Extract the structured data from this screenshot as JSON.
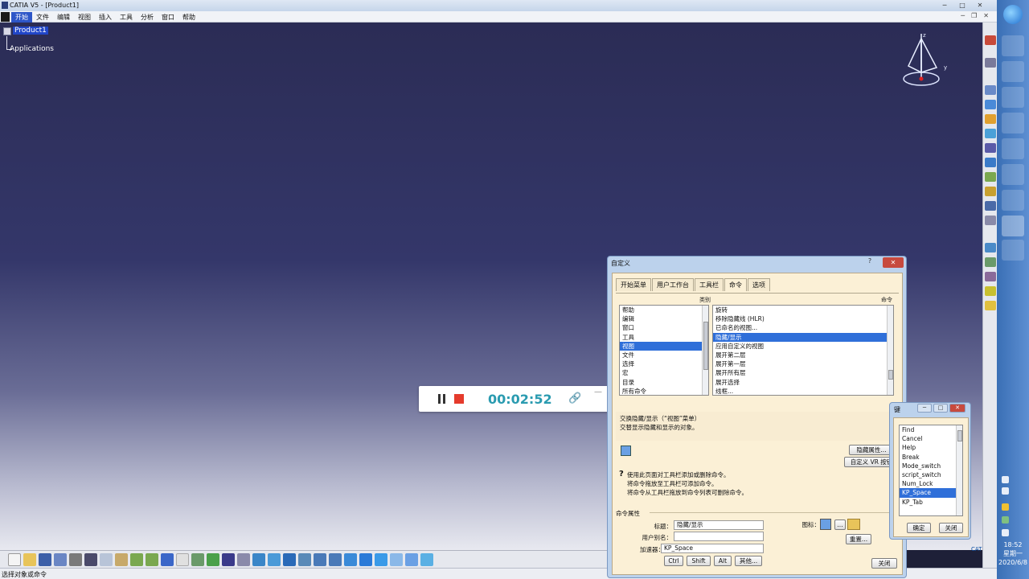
{
  "window": {
    "title": "CATIA V5 - [Product1]",
    "min": "─",
    "max": "□",
    "close": "✕",
    "mdi_min": "─",
    "mdi_restore": "❐",
    "mdi_close": "✕"
  },
  "menu": [
    "开始",
    "文件",
    "编辑",
    "视图",
    "插入",
    "工具",
    "分析",
    "窗口",
    "帮助"
  ],
  "tree": {
    "root": "Product1",
    "child": "Applications"
  },
  "compass": {
    "axis_z": "z",
    "axis_y": "y"
  },
  "recorder": {
    "time": "00:02:52",
    "link_icon": "🔗",
    "minimize": "—"
  },
  "status": {
    "text": "选择对象或命令"
  },
  "catia_logo": "CATIA",
  "taskbar": {
    "time": "18:52",
    "day": "星期一",
    "date": "2020/6/8"
  },
  "customize": {
    "title": "自定义",
    "help": "?",
    "close": "✕",
    "tabs": [
      "开始菜单",
      "用户工作台",
      "工具栏",
      "命令",
      "选项"
    ],
    "selected_tab": "命令",
    "categories_header": "类别",
    "commands_header": "命令",
    "categories": [
      "帮助",
      "编辑",
      "窗口",
      "工具",
      "视图",
      "文件",
      "选择",
      "宏",
      "目录",
      "所有命令"
    ],
    "selected_category": "视图",
    "commands": [
      "旋转",
      "移除隐藏线 (HLR)",
      "已命名的视图...",
      "隐藏/显示",
      "应用自定义的视图",
      "展开第二层",
      "展开第一层",
      "展开所有层",
      "展开选择",
      "线框..."
    ],
    "selected_command": "隐藏/显示",
    "description_line1": "交换隐藏/显示（“视图”菜单）",
    "description_line2": "交替显示隐藏和显示的对象。",
    "btn_hide_props": "隐藏属性...",
    "btn_custom_vr": "自定义 VR 按钮",
    "hint_lines": [
      "使用此页面对工具栏添加或删除命令。",
      "将命令拖放至工具栏可添加命令。",
      "将命令从工具栏拖放到命令列表可删除命令。"
    ],
    "props_header": "命令属性",
    "label_title": "标题：",
    "value_title": "隐藏/显示",
    "label_alias": "用户别名：",
    "value_alias": "",
    "label_accel": "加速器：",
    "value_accel": "KP_Space",
    "label_icon": "图标：",
    "btn_ellipsis": "...",
    "mod_buttons": [
      "Ctrl",
      "Shift",
      "Alt",
      "其他..."
    ],
    "btn_reset": "重置...",
    "btn_close": "关闭"
  },
  "keys": {
    "title": "键",
    "list": [
      "Find",
      "Cancel",
      "Help",
      "Break",
      "Mode_switch",
      "script_switch",
      "Num_Lock",
      "KP_Space",
      "KP_Tab"
    ],
    "selected": "KP_Space",
    "btn_ok": "确定",
    "btn_close": "关闭"
  },
  "colors": {
    "accent": "#2f6fd9",
    "dialog_bg": "#fbf0d6",
    "viewport_top": "#2b2c55",
    "recorder_time": "#2a9bb0",
    "stop": "#e53b2c"
  }
}
